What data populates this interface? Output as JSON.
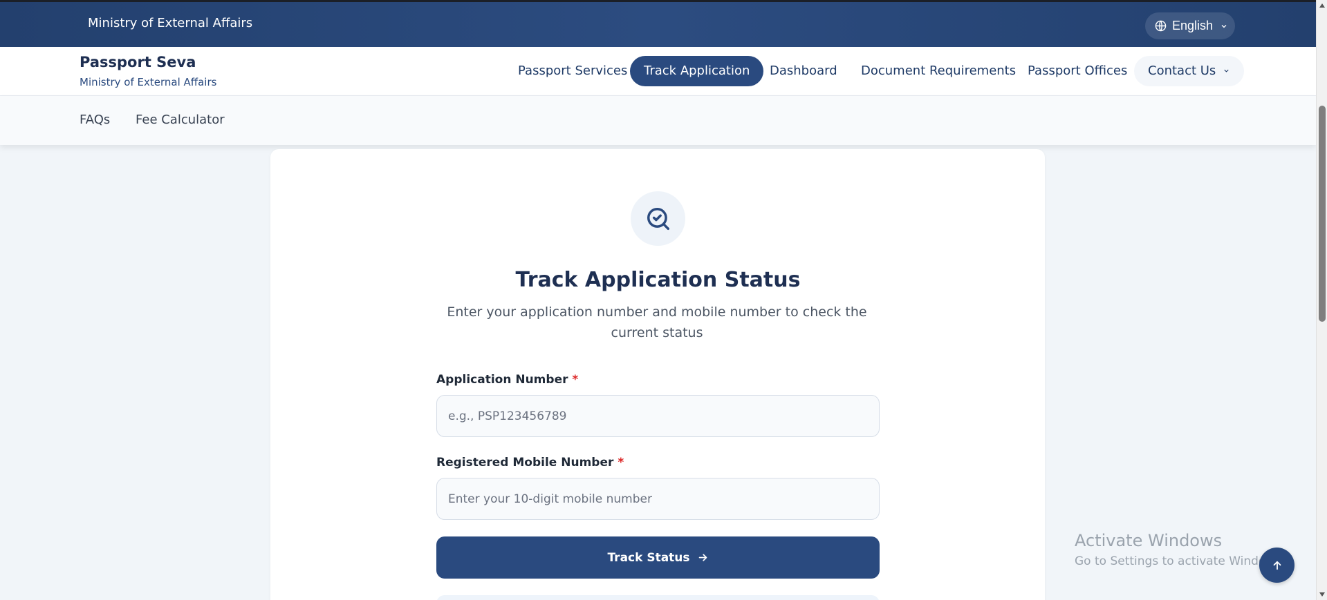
{
  "topbar": {
    "ministry": "Ministry of External Affairs",
    "language": "English"
  },
  "brand": {
    "title": "Passport Seva",
    "subtitle": "Ministry of External Affairs"
  },
  "nav": {
    "items": [
      {
        "label": "Passport Services"
      },
      {
        "label": "Track Application"
      },
      {
        "label": "Dashboard"
      },
      {
        "label": "Document Requirements"
      },
      {
        "label": "Passport Offices"
      },
      {
        "label": "Contact Us"
      }
    ],
    "active": "Track Application"
  },
  "subnav": {
    "items": [
      {
        "label": "FAQs"
      },
      {
        "label": "Fee Calculator"
      }
    ]
  },
  "form": {
    "title": "Track Application Status",
    "subtitle": "Enter your application number and mobile number to check the current status",
    "app_label": "Application Number",
    "app_placeholder": "e.g., PSP123456789",
    "mobile_label": "Registered Mobile Number",
    "mobile_placeholder": "Enter your 10-digit mobile number",
    "required_mark": "*",
    "submit_label": "Track Status"
  },
  "watermark": {
    "title": "Activate Windows",
    "subtitle": "Go to Settings to activate Windows."
  },
  "colors": {
    "primary": "#2a4a7f",
    "header": "#23406e",
    "required": "#dc2626"
  }
}
